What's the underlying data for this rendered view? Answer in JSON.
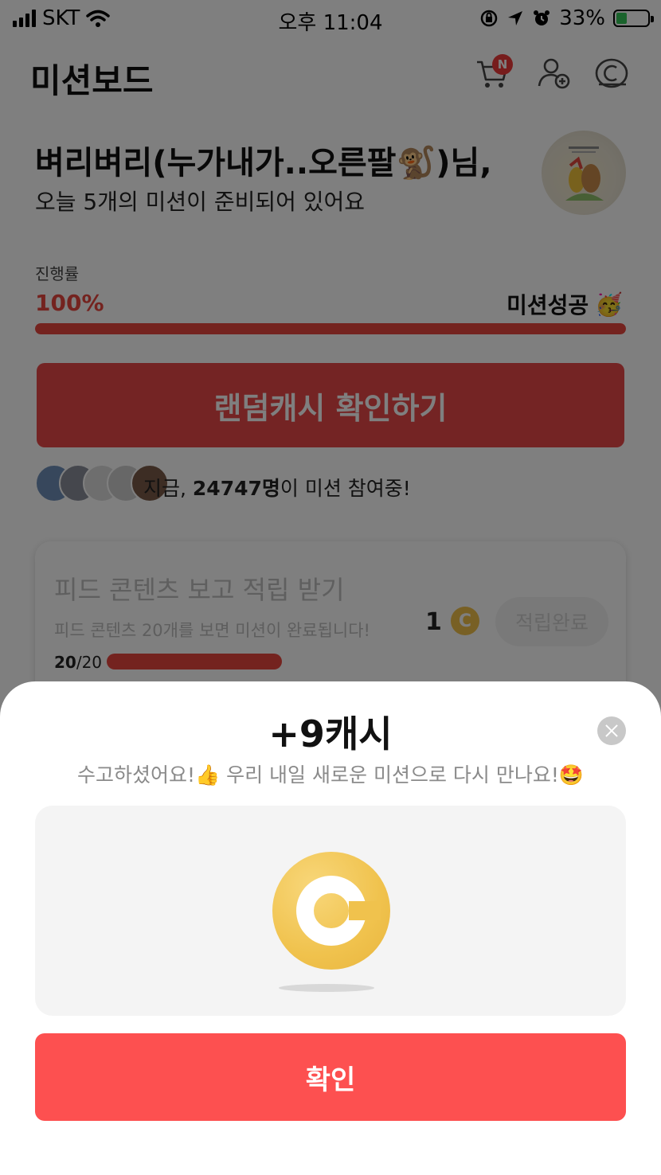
{
  "status_bar": {
    "carrier": "SKT",
    "time": "오후 11:04",
    "battery_percent": "33%",
    "battery_level": 0.33
  },
  "header": {
    "title": "미션보드",
    "cart_badge": "N"
  },
  "greeting": {
    "name_line": "벼리벼리(누가내가..오른팔🐒)님,",
    "sub_line": "오늘 5개의 미션이 준비되어 있어요"
  },
  "progress": {
    "label": "진행률",
    "value_text": "100%",
    "value": 1.0,
    "status": "미션성공",
    "status_emoji": "🥳",
    "color": "#e8463f"
  },
  "cta": {
    "label": "랜덤캐시 확인하기"
  },
  "participants": {
    "prefix": "지금, ",
    "count": "24747명",
    "suffix": "이 미션 참여중!"
  },
  "mission": {
    "title": "피드 콘텐츠 보고 적립 받기",
    "description": "피드 콘텐츠 20개를 보면 미션이 완료됩니다!",
    "progress_current": "20",
    "progress_total": "/20",
    "reward": "1",
    "coin_symbol": "C",
    "button_label": "적립완료"
  },
  "sheet": {
    "title": "+9캐시",
    "message": "수고하셨어요!👍 우리 내일 새로운 미션으로 다시 만나요!🤩",
    "confirm_label": "확인",
    "confirm_color": "#fd5050",
    "coin_color": "#f0c24d"
  },
  "icons": [
    "signal-icon",
    "wifi-icon",
    "lock-rotation-icon",
    "location-icon",
    "alarm-icon",
    "battery-icon",
    "cart-icon",
    "add-friend-icon",
    "cash-icon",
    "close-icon",
    "coin-icon"
  ]
}
